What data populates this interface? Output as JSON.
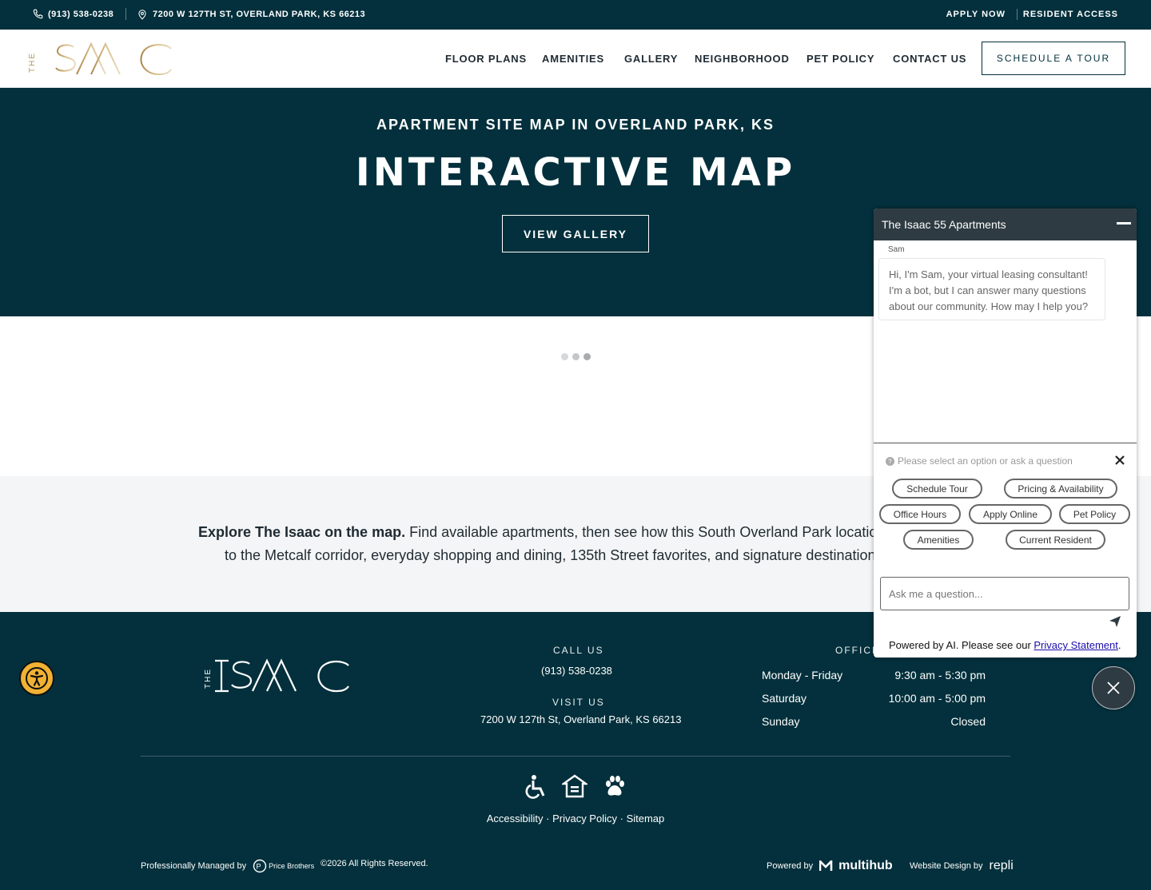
{
  "topbar": {
    "phone": "(913) 538-0238",
    "address": "7200 W 127TH ST, OVERLAND PARK, KS 66213",
    "apply_now": "APPLY NOW",
    "resident_access": "RESIDENT ACCESS"
  },
  "header": {
    "logo_text": "THE ISAAC",
    "nav": [
      "FLOOR PLANS",
      "AMENITIES",
      "GALLERY",
      "NEIGHBORHOOD",
      "PET POLICY",
      "CONTACT US"
    ],
    "cta": "SCHEDULE A TOUR"
  },
  "hero": {
    "kicker": "APARTMENT SITE MAP IN OVERLAND PARK, KS",
    "title": "INTERACTIVE MAP",
    "button": "VIEW GALLERY"
  },
  "explore": {
    "bold": "Explore The Isaac on the map.",
    "line1_rest": " Find available apartments, then see how this South Overland Park location c",
    "line2": "to the Metcalf corridor, everyday shopping and dining, 135th Street favorites, and signature destinations"
  },
  "footer": {
    "logo_text": "THE ISAAC",
    "call_label": "CALL US",
    "phone": "(913) 538-0238",
    "visit_label": "VISIT US",
    "address": "7200 W 127th St, Overland Park, KS 66213",
    "office_label": "OFFICE",
    "hours": [
      {
        "day": "Monday - Friday",
        "time": "9:30 am - 5:30 pm"
      },
      {
        "day": "Saturday",
        "time": "10:00 am - 5:00 pm"
      },
      {
        "day": "Sunday",
        "time": "Closed"
      }
    ],
    "links": [
      "Accessibility",
      "Privacy Policy",
      "Sitemap"
    ],
    "link_sep": " · ",
    "managed_by": "Professionally Managed by",
    "managed_brand": "Price Brothers",
    "copyright": "©2026 All Rights Reserved.",
    "powered_by": "Powered by",
    "multihub": "multihub",
    "website_design": "Website Design by",
    "repli": "repli"
  },
  "chat": {
    "title": "The Isaac 55 Apartments",
    "sender": "Sam",
    "message": "Hi, I'm Sam, your virtual leasing consultant! I'm a bot, but I can answer many questions about our community. How may I help you?",
    "hint": "Please select an option or ask a question",
    "chips": [
      "Schedule Tour",
      "Pricing & Availability",
      "Office Hours",
      "Apply Online",
      "Pet Policy",
      "Amenities",
      "Current Resident"
    ],
    "input_placeholder": "Ask me a question...",
    "powered_text": "Powered by AI. Please see our ",
    "privacy_link": "Privacy Statement",
    "powered_end": "."
  },
  "colors": {
    "brand_dark": "#03303c",
    "gold": "#b8955a",
    "chat_header": "#2e3b42",
    "accessibility": "#f1b233"
  }
}
